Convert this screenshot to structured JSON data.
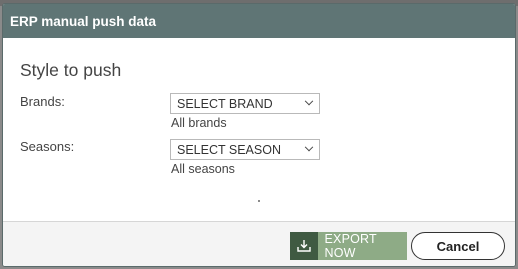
{
  "modal": {
    "title": "ERP manual push data"
  },
  "body": {
    "section_title": "Style to push",
    "brands": {
      "label": "Brands:",
      "selected": "SELECT BRAND",
      "hint": "All brands"
    },
    "seasons": {
      "label": "Seasons:",
      "selected": "SELECT SEASON",
      "hint": "All seasons"
    }
  },
  "footer": {
    "export_label": "EXPORT NOW",
    "export_icon": "download-icon",
    "cancel_label": "Cancel"
  },
  "colors": {
    "header_bg": "#5f7575",
    "export_bg": "#8eab86",
    "export_icon_bg": "#3f5a42"
  }
}
